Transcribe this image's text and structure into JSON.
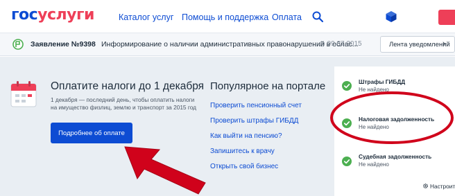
{
  "header": {
    "logo_part1": "гос",
    "logo_part2": "услуги",
    "nav": [
      "Каталог услуг",
      "Помощь и поддержка",
      "Оплата"
    ],
    "icons": [
      "search-icon",
      "profile-icon",
      "menu-icon"
    ]
  },
  "notification": {
    "number": "Заявление №9398",
    "text": "Информирование о наличии административных правонарушений в облас...",
    "date": "09.07.2015",
    "feed_label": "Лента уведомлений",
    "feed_chevron": "›"
  },
  "tax": {
    "title": "Оплатите налоги до 1 декабря",
    "description": "1 декабря — последний день, чтобы оплатить налоги на имущество физлиц, землю и транспорт за 2015 год",
    "button": "Подробнее об оплате"
  },
  "popular": {
    "title": "Популярное на портале",
    "links": [
      "Проверить пенсионный счет",
      "Проверить штрафы ГИБДД",
      "Как выйти на пенсию?",
      "Запишитесь к врачу",
      "Открыть свой бизнес"
    ]
  },
  "status_panel": {
    "items": [
      {
        "title": "Штрафы ГИБДД",
        "status": "Не найдено"
      },
      {
        "title": "Налоговая задолженность",
        "status": "Не найдено"
      },
      {
        "title": "Судебная задолженность",
        "status": "Не найдено"
      }
    ],
    "settings": "Настроить"
  },
  "colors": {
    "brand_blue": "#0d4cd3",
    "brand_red": "#ee3f58",
    "check_green": "#4caf50",
    "annotation_red": "#d0021b",
    "background": "#e9eef3"
  }
}
